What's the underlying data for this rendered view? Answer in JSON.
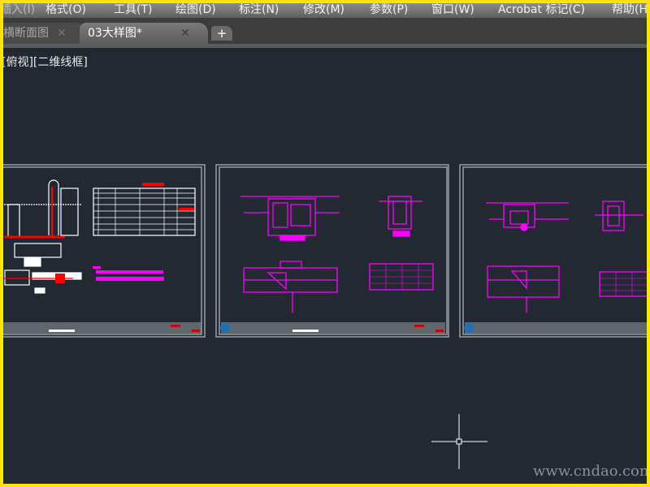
{
  "menubar": {
    "items": [
      {
        "label": "插入(I)"
      },
      {
        "label": "格式(O)"
      },
      {
        "label": "工具(T)"
      },
      {
        "label": "绘图(D)"
      },
      {
        "label": "标注(N)"
      },
      {
        "label": "修改(M)"
      },
      {
        "label": "参数(P)"
      },
      {
        "label": "窗口(W)"
      },
      {
        "label": "Acrobat 标记(C)"
      },
      {
        "label": "帮助(H)"
      }
    ]
  },
  "tabs": [
    {
      "label": "横断面图",
      "close": "✕",
      "active": false
    },
    {
      "label": "03大样图*",
      "close": "✕",
      "active": true
    }
  ],
  "add_tab": "+",
  "viewport": {
    "label": "[俯视][二维线框]"
  },
  "watermark": "www.cndao.com",
  "colors": {
    "canvas": "#222933",
    "magenta": "#ff00ff",
    "red": "#ff0000",
    "frame": "#ffe600"
  }
}
